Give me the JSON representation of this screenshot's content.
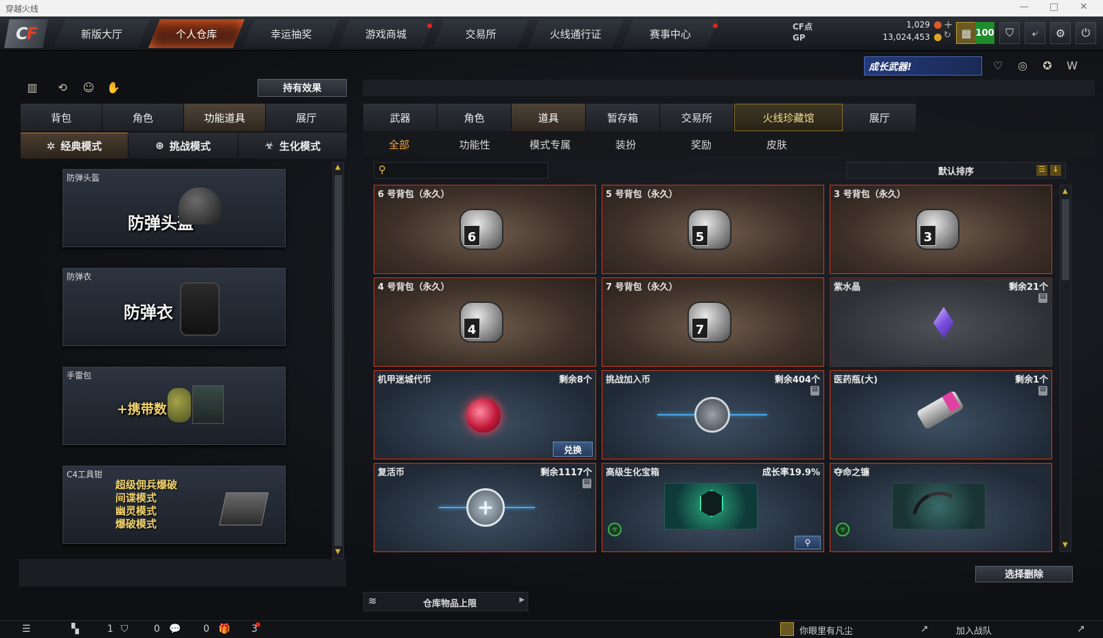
{
  "window": {
    "title": "穿越火线"
  },
  "nav": {
    "tabs": [
      "新版大厅",
      "个人仓库",
      "幸运抽奖",
      "游戏商城",
      "交易所",
      "火线通行证",
      "赛事中心"
    ],
    "active": "个人仓库"
  },
  "currency": {
    "cf_label": "CF点",
    "cf_value": "1,029",
    "gp_label": "GP",
    "gp_value": "13,024,453",
    "level_badge": "100"
  },
  "left": {
    "effect_button": "持有效果",
    "tabs": [
      "背包",
      "角色",
      "功能道具",
      "展厅"
    ],
    "active_tab": "功能道具",
    "modes": [
      "经典模式",
      "挑战模式",
      "生化模式"
    ],
    "active_mode": "经典模式",
    "cards": [
      {
        "label": "防弹头盔",
        "big": "防弹头盔"
      },
      {
        "label": "防弹衣",
        "big": "防弹衣"
      },
      {
        "label": "手雷包",
        "big": "+携带数"
      },
      {
        "label": "C4工具钳",
        "lines": [
          "超级佣兵爆破",
          "间谍模式",
          "幽灵模式",
          "爆破模式"
        ]
      }
    ]
  },
  "right": {
    "banner": "成长武器!",
    "tabs": [
      "武器",
      "角色",
      "道具",
      "暂存箱",
      "交易所",
      "火线珍藏馆",
      "展厅"
    ],
    "active_tab": "道具",
    "subtabs": [
      "全部",
      "功能性",
      "模式专属",
      "装扮",
      "奖励",
      "皮肤"
    ],
    "active_subtab": "全部",
    "search_placeholder": "",
    "sort_label": "默认排序",
    "items": [
      {
        "name": "6 号背包（永久）",
        "qty": "",
        "kind": "bag",
        "bag_no": "6"
      },
      {
        "name": "5 号背包（永久）",
        "qty": "",
        "kind": "bag",
        "bag_no": "5"
      },
      {
        "name": "3 号背包（永久）",
        "qty": "",
        "kind": "bag",
        "bag_no": "3"
      },
      {
        "name": "4 号背包（永久）",
        "qty": "",
        "kind": "bag",
        "bag_no": "4"
      },
      {
        "name": "7 号背包（永久）",
        "qty": "",
        "kind": "bag",
        "bag_no": "7"
      },
      {
        "name": "紫水晶",
        "qty": "剩余21个",
        "kind": "gem"
      },
      {
        "name": "机甲迷城代币",
        "qty": "剩余8个",
        "kind": "coin",
        "action": "兑换"
      },
      {
        "name": "挑战加入币",
        "qty": "剩余404个",
        "kind": "challenge"
      },
      {
        "name": "医药瓶(大)",
        "qty": "剩余1个",
        "kind": "medic"
      },
      {
        "name": "复活币",
        "qty": "剩余1117个",
        "kind": "revive"
      },
      {
        "name": "高级生化宝箱",
        "qty": "成长率19.9%",
        "kind": "box"
      },
      {
        "name": "夺命之镰",
        "qty": "",
        "kind": "scythe"
      }
    ],
    "delete_button": "选择删除",
    "storage_label": "仓库物品上限"
  },
  "bottom": {
    "counts": [
      "1",
      "0",
      "0",
      "3"
    ],
    "friend_name": "你眼里有凡尘",
    "join_team": "加入战队"
  },
  "colors": {
    "accent": "#f2a63c",
    "card_border": "#c0412b",
    "nav_active": "#7a2c14"
  }
}
